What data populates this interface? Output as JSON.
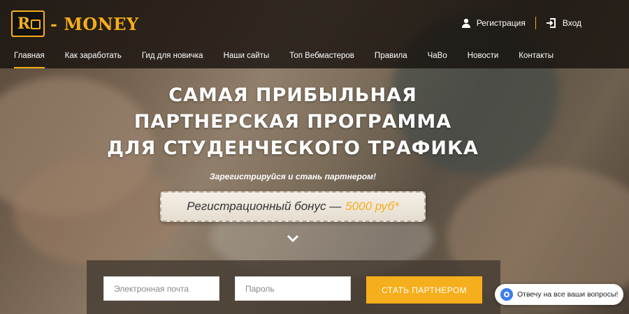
{
  "logo": {
    "mark": "R",
    "text": "- MONEY"
  },
  "auth": {
    "register_label": "Регистрация",
    "login_label": "Вход"
  },
  "nav": {
    "items": [
      {
        "label": "Главная",
        "active": true
      },
      {
        "label": "Как заработать"
      },
      {
        "label": "Гид для новичка"
      },
      {
        "label": "Наши сайты"
      },
      {
        "label": "Топ Вебмастеров"
      },
      {
        "label": "Правила"
      },
      {
        "label": "ЧаВо"
      },
      {
        "label": "Новости"
      },
      {
        "label": "Контакты"
      }
    ]
  },
  "hero": {
    "title_lines": [
      "САМАЯ ПРИБЫЛЬНАЯ",
      "ПАРТНЕРСКАЯ ПРОГРАММА",
      "ДЛЯ СТУДЕНЧЕСКОГО ТРАФИКА"
    ],
    "subtitle": "Зарегистрируйся и стань партнером!",
    "bonus_text": "Регистрационный бонус —",
    "bonus_amount": "5000 руб*"
  },
  "form": {
    "email_placeholder": "Электронная почта",
    "password_placeholder": "Пароль",
    "submit_label": "СТАТЬ ПАРТНЕРОМ"
  },
  "chat": {
    "label": "Отвечу на все ваши вопросы!"
  },
  "colors": {
    "accent": "#f5ae1c",
    "topbar": "#14100c"
  }
}
